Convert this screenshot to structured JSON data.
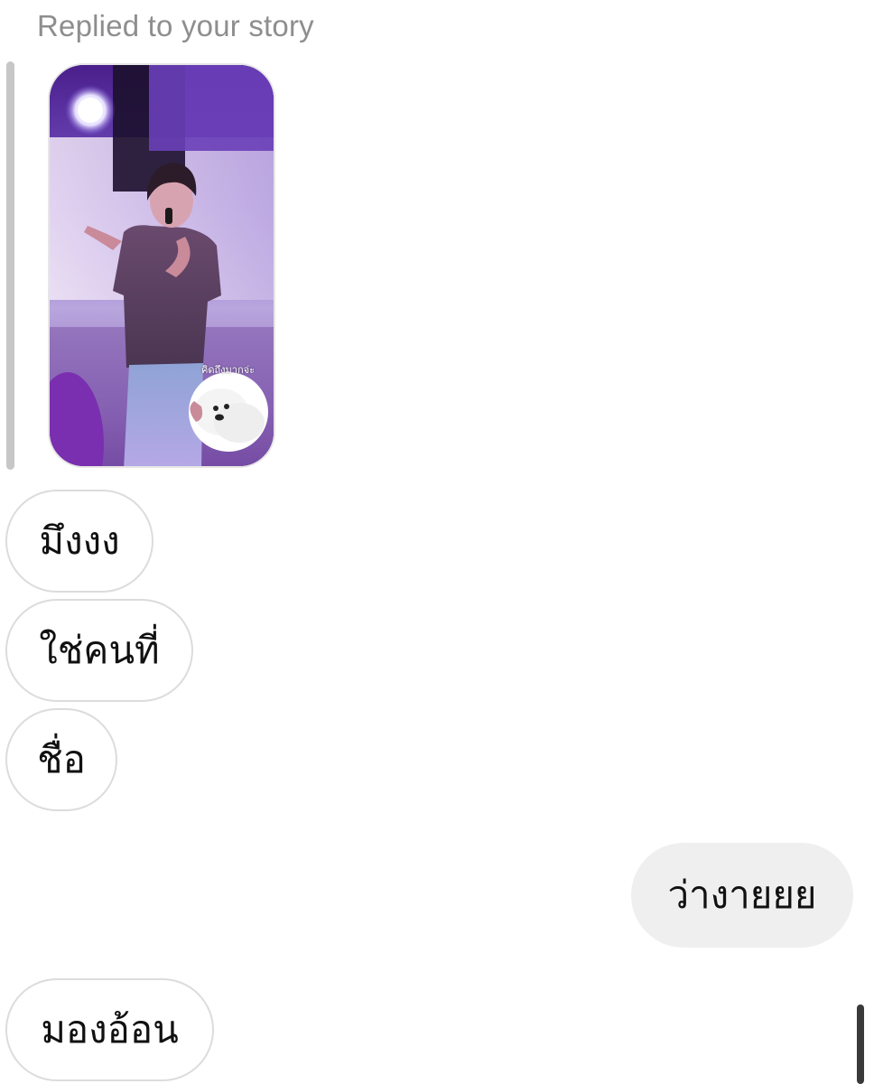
{
  "thread": {
    "replied_label": "Replied to your story",
    "story": {
      "sticker_caption": "คิดถึงมากจ่ะ"
    },
    "messages": [
      {
        "text": "มึงงง",
        "direction": "received"
      },
      {
        "text": "ใช่คนที่",
        "direction": "received"
      },
      {
        "text": "ชื่อ",
        "direction": "received"
      },
      {
        "text": "ว่างายยย",
        "direction": "sent"
      },
      {
        "text": "มองอ้อน",
        "direction": "received"
      }
    ]
  },
  "colors": {
    "received_bubble_border": "#dcdcdc",
    "sent_bubble_bg": "#efefef",
    "label_gray": "#8e8e8e",
    "story_purple": "#5b2a86"
  }
}
